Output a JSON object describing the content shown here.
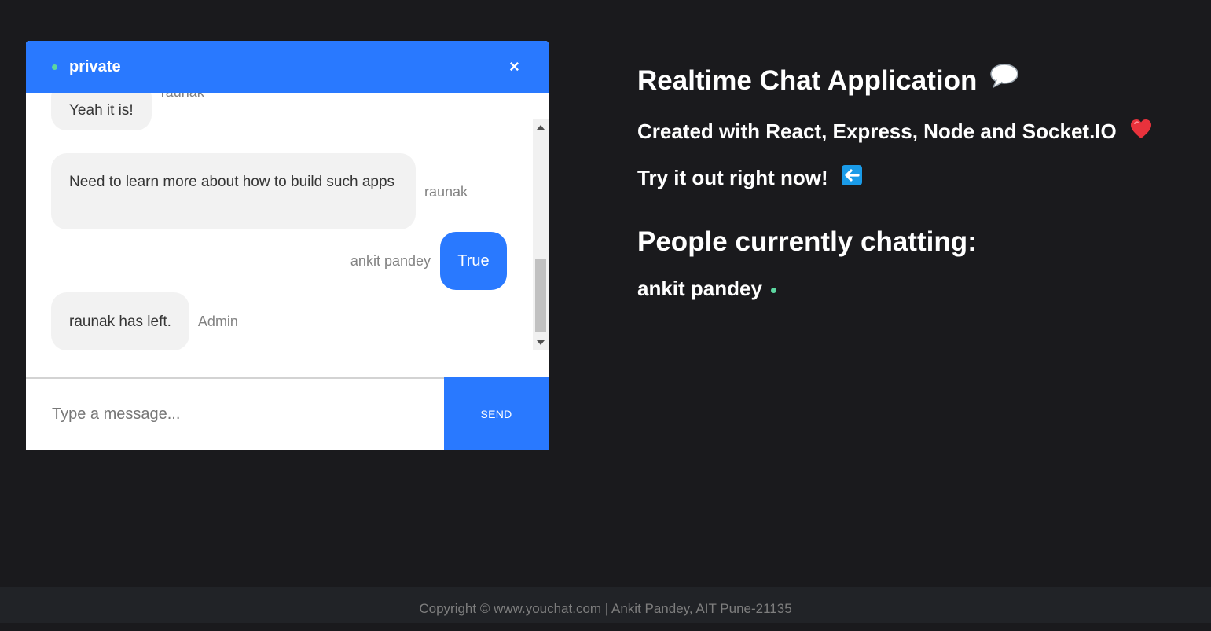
{
  "chat": {
    "room_name": "private",
    "close_symbol": "×",
    "messages": [
      {
        "text": "Yeah it is!",
        "sender": "raunak",
        "align": "left"
      },
      {
        "text": "Need to learn more about how to build such apps",
        "sender": "raunak",
        "align": "left"
      },
      {
        "text": "True",
        "sender": "ankit pandey",
        "align": "right"
      },
      {
        "text": "raunak has left.",
        "sender": "Admin",
        "align": "left"
      }
    ],
    "input_placeholder": "Type a message...",
    "send_label": "SEND"
  },
  "info": {
    "title": "Realtime Chat Application",
    "title_icon": "speech-bubble-icon",
    "subtitle": "Created with React, Express, Node and Socket.IO",
    "subtitle_icon": "heart-icon",
    "cta": "Try it out right now!",
    "cta_icon": "left-arrow-icon",
    "people_heading": "People currently chatting:",
    "people": [
      "ankit pandey"
    ]
  },
  "footer": {
    "text": "Copyright © www.youchat.com | Ankit Pandey, AIT Pune-21135"
  },
  "colors": {
    "page_background": "#1a1a1d",
    "accent": "#2979ff",
    "online": "#5cd6a0",
    "bubble_light": "#f2f2f2",
    "footer_background": "#212327"
  }
}
